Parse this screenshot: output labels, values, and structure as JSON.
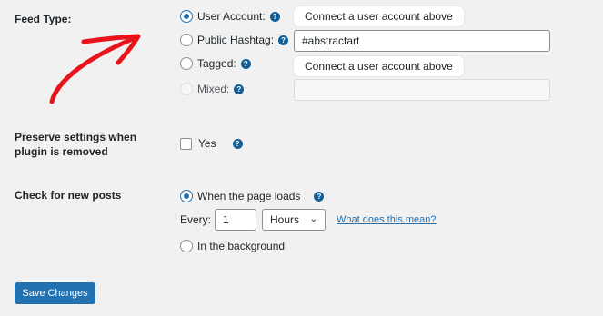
{
  "feed_type": {
    "label": "Feed Type:",
    "options": [
      {
        "label": "User Account:",
        "state": "selected",
        "field_text": "Connect a user account above"
      },
      {
        "label": "Public Hashtag:",
        "state": "unselected",
        "field_value": "#abstractart"
      },
      {
        "label": "Tagged:",
        "state": "unselected",
        "field_text": "Connect a user account above"
      },
      {
        "label": "Mixed:",
        "state": "disabled",
        "field_value": ""
      }
    ],
    "help_glyph": "?"
  },
  "preserve": {
    "label_line1": "Preserve settings when",
    "label_line2": "plugin is removed",
    "checkbox_label": "Yes",
    "checked": false
  },
  "check_posts": {
    "label": "Check for new posts",
    "option_page_load": "When the page loads",
    "every_label": "Every:",
    "every_value": "1",
    "unit_value": "Hours",
    "link_text": "What does this mean?",
    "option_background": "In the background"
  },
  "save_button": "Save Changes",
  "colors": {
    "accent": "#2271b1",
    "arrow": "#e8131b",
    "background": "#f1f1f1"
  }
}
